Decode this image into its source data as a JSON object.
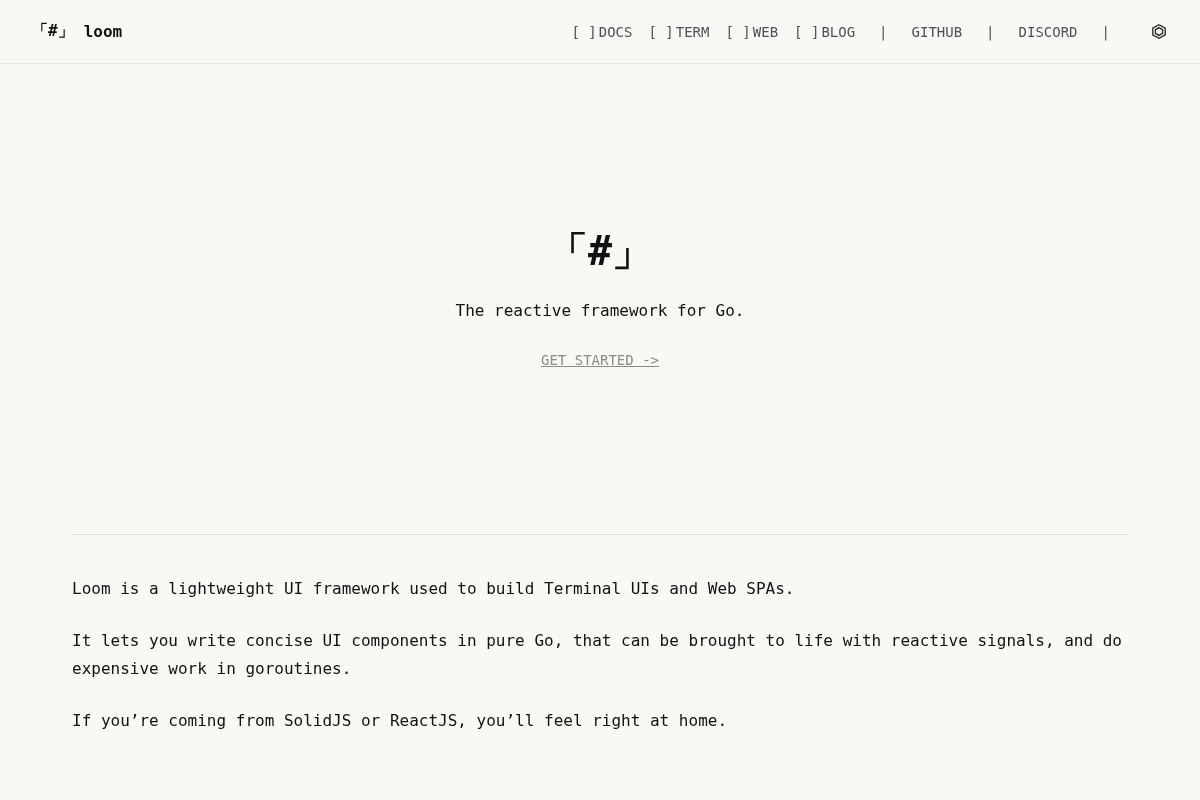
{
  "header": {
    "logo_mark": "「#」",
    "logo_text": "loom",
    "nav": [
      {
        "kind": "link",
        "marker": "[ ]",
        "label": "DOCS"
      },
      {
        "kind": "link",
        "marker": "[ ]",
        "label": "TERM"
      },
      {
        "kind": "link",
        "marker": "[ ]",
        "label": "WEB"
      },
      {
        "kind": "link",
        "marker": "[ ]",
        "label": "BLOG"
      },
      {
        "kind": "separator",
        "text": "|"
      },
      {
        "kind": "external",
        "label": "GITHUB"
      },
      {
        "kind": "separator",
        "text": "|"
      },
      {
        "kind": "external",
        "label": "DISCORD"
      },
      {
        "kind": "separator",
        "text": "|"
      }
    ]
  },
  "hero": {
    "logo": "「#」",
    "tagline": "The reactive framework for Go.",
    "cta": "GET STARTED ->"
  },
  "intro": {
    "paragraphs": [
      "Loom is a lightweight UI framework used to build Terminal UIs and Web SPAs.",
      "It lets you write concise UI components in pure Go, that can be brought to life with reactive signals, and do expensive work in goroutines.",
      "If you’re coming from SolidJS or ReactJS, you’ll feel right at home."
    ]
  }
}
